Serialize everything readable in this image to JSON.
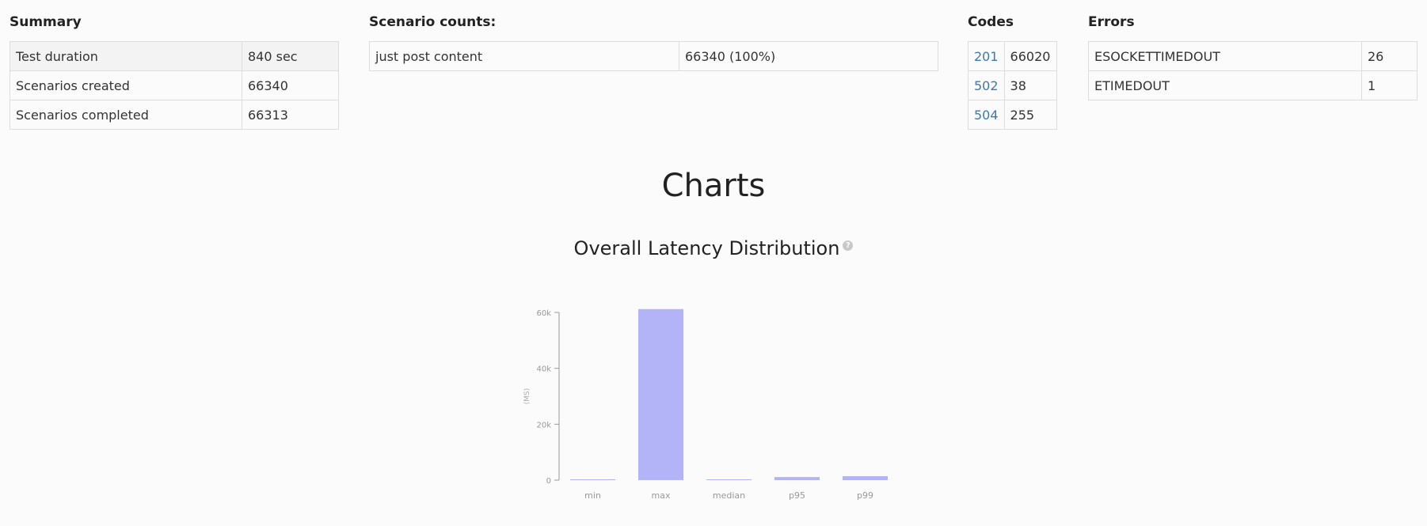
{
  "summary": {
    "title": "Summary",
    "rows": [
      {
        "label": "Test duration",
        "value": "840 sec"
      },
      {
        "label": "Scenarios created",
        "value": "66340"
      },
      {
        "label": "Scenarios completed",
        "value": "66313"
      }
    ]
  },
  "scenario_counts": {
    "title": "Scenario counts:",
    "rows": [
      {
        "label": "just post content",
        "value": "66340 (100%)"
      }
    ]
  },
  "codes": {
    "title": "Codes",
    "rows": [
      {
        "label": "201",
        "value": "66020"
      },
      {
        "label": "502",
        "value": "38"
      },
      {
        "label": "504",
        "value": "255"
      }
    ]
  },
  "errors": {
    "title": "Errors",
    "rows": [
      {
        "label": "ESOCKETTIMEDOUT",
        "value": "26"
      },
      {
        "label": "ETIMEDOUT",
        "value": "1"
      }
    ]
  },
  "charts": {
    "heading": "Charts",
    "latency_title": "Overall Latency Distribution",
    "help_glyph": "?"
  },
  "chart_data": {
    "type": "bar",
    "title": "Overall Latency Distribution",
    "categories": [
      "min",
      "max",
      "median",
      "p95",
      "p99"
    ],
    "values": [
      20,
      61200,
      250,
      1100,
      1400
    ],
    "ylabel": "(MS)",
    "ylim": [
      0,
      60000
    ],
    "yticks": [
      0,
      20000,
      40000,
      60000
    ],
    "ytick_labels": [
      "0",
      "20k",
      "40k",
      "60k"
    ],
    "bar_color": "#b3b3f7",
    "grid": false
  },
  "colors": {
    "link": "#3e78b2",
    "bar": "#b3b3f7"
  }
}
